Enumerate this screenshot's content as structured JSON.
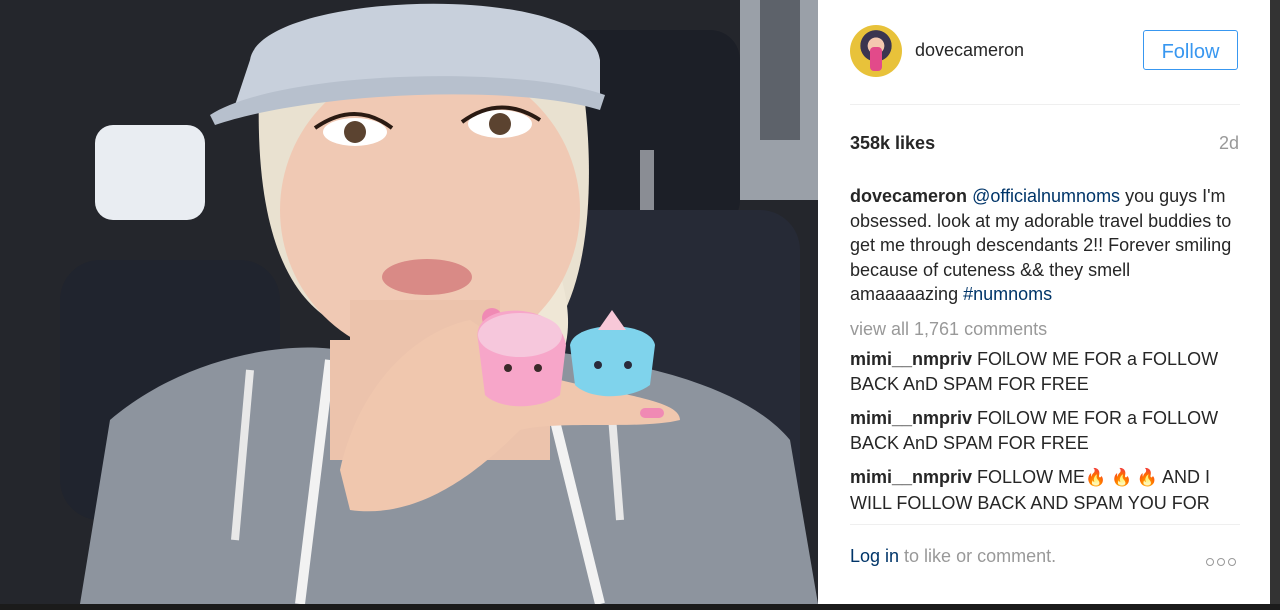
{
  "post": {
    "image_alt": "selfie photo",
    "username": "dovecameron",
    "follow_label": "Follow",
    "likes": "358k likes",
    "age": "2d",
    "caption": {
      "user": "dovecameron",
      "mention": "@officialnumnoms",
      "text": " you guys I'm obsessed. look at my adorable travel buddies to get me through descendants 2!! Forever smiling because of cuteness && they smell amaaaaazing ",
      "hashtag": "#numnoms"
    },
    "view_all": "view all 1,761 comments",
    "comments": [
      {
        "user": "mimi__nmpriv",
        "text": " FOlLOW ME FOR a FOLLOW BACK AnD SPAM FOR FREE"
      },
      {
        "user": "mimi__nmpriv",
        "text": " FOlLOW ME FOR a FOLLOW BACK AnD SPAM FOR FREE"
      },
      {
        "user": "mimi__nmpriv",
        "text_before": " FOLLOW ME",
        "emoji": "🔥 🔥 🔥",
        "text_after": " AND I WILL FOLLOW BACK AND SPAM YOU FOR"
      }
    ],
    "login_link": "Log in",
    "login_rest": " to like or comment.",
    "icons": {
      "more": "more-options-icon",
      "avatar": "avatar"
    }
  }
}
